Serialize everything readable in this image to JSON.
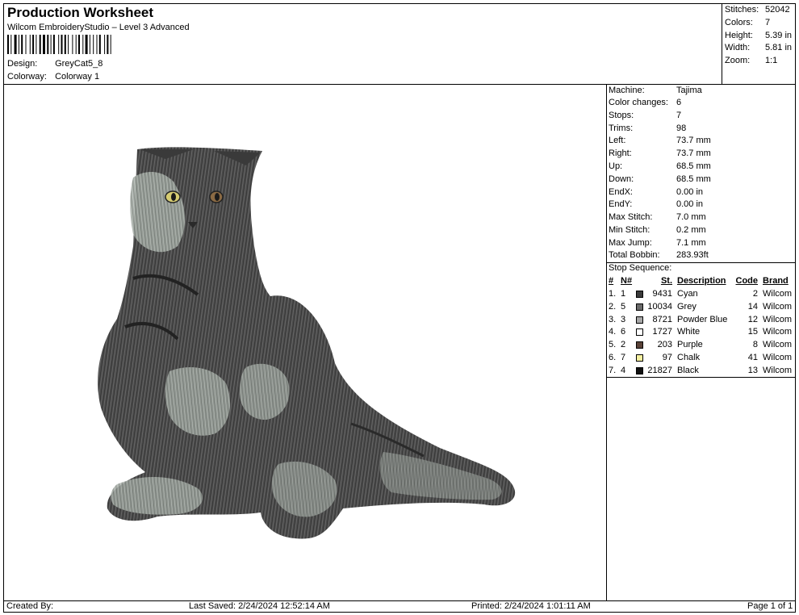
{
  "header": {
    "title": "Production Worksheet",
    "subtitle": "Wilcom EmbroideryStudio – Level 3 Advanced",
    "design_label": "Design:",
    "design_value": "GreyCat5_8",
    "colorway_label": "Colorway:",
    "colorway_value": "Colorway 1"
  },
  "summary": [
    {
      "label": "Stitches:",
      "value": "52042"
    },
    {
      "label": "Colors:",
      "value": "7"
    },
    {
      "label": "Height:",
      "value": "5.39 in"
    },
    {
      "label": "Width:",
      "value": "5.81 in"
    },
    {
      "label": "Zoom:",
      "value": "1:1"
    }
  ],
  "machine_info": [
    {
      "label": "Machine:",
      "value": "Tajima"
    },
    {
      "label": "Color changes:",
      "value": "6"
    },
    {
      "label": "Stops:",
      "value": "7"
    },
    {
      "label": "Trims:",
      "value": "98"
    },
    {
      "label": "Left:",
      "value": "73.7 mm"
    },
    {
      "label": "Right:",
      "value": "73.7 mm"
    },
    {
      "label": "Up:",
      "value": "68.5 mm"
    },
    {
      "label": "Down:",
      "value": "68.5 mm"
    },
    {
      "label": "EndX:",
      "value": "0.00 in"
    },
    {
      "label": "EndY:",
      "value": "0.00 in"
    },
    {
      "label": "Max Stitch:",
      "value": "7.0 mm"
    },
    {
      "label": "Min Stitch:",
      "value": "0.2 mm"
    },
    {
      "label": "Max Jump:",
      "value": "7.1 mm"
    },
    {
      "label": "Total Bobbin:",
      "value": "283.93ft"
    }
  ],
  "stop_sequence": {
    "title": "Stop Sequence:",
    "headers": {
      "num": "#",
      "n_num": "N#",
      "st": "St.",
      "description": "Description",
      "code": "Code",
      "brand": "Brand"
    },
    "rows": [
      {
        "num": "1.",
        "n": "1",
        "color": "#3a3a3a",
        "st": "9431",
        "description": "Cyan",
        "code": "2",
        "brand": "Wilcom"
      },
      {
        "num": "2.",
        "n": "5",
        "color": "#6a6a6a",
        "st": "10034",
        "description": "Grey",
        "code": "14",
        "brand": "Wilcom"
      },
      {
        "num": "3.",
        "n": "3",
        "color": "#a8a8a8",
        "st": "8721",
        "description": "Powder Blue",
        "code": "12",
        "brand": "Wilcom"
      },
      {
        "num": "4.",
        "n": "6",
        "color": "#ffffff",
        "st": "1727",
        "description": "White",
        "code": "15",
        "brand": "Wilcom"
      },
      {
        "num": "5.",
        "n": "2",
        "color": "#5a4238",
        "st": "203",
        "description": "Purple",
        "code": "8",
        "brand": "Wilcom"
      },
      {
        "num": "6.",
        "n": "7",
        "color": "#f5f0a0",
        "st": "97",
        "description": "Chalk",
        "code": "41",
        "brand": "Wilcom"
      },
      {
        "num": "7.",
        "n": "4",
        "color": "#111111",
        "st": "21827",
        "description": "Black",
        "code": "13",
        "brand": "Wilcom"
      }
    ]
  },
  "footer": {
    "created_by": "Created By:",
    "last_saved": "Last Saved: 2/24/2024 12:52:14 AM",
    "printed": "Printed: 2/24/2024 1:01:11 AM",
    "page": "Page 1 of 1"
  }
}
